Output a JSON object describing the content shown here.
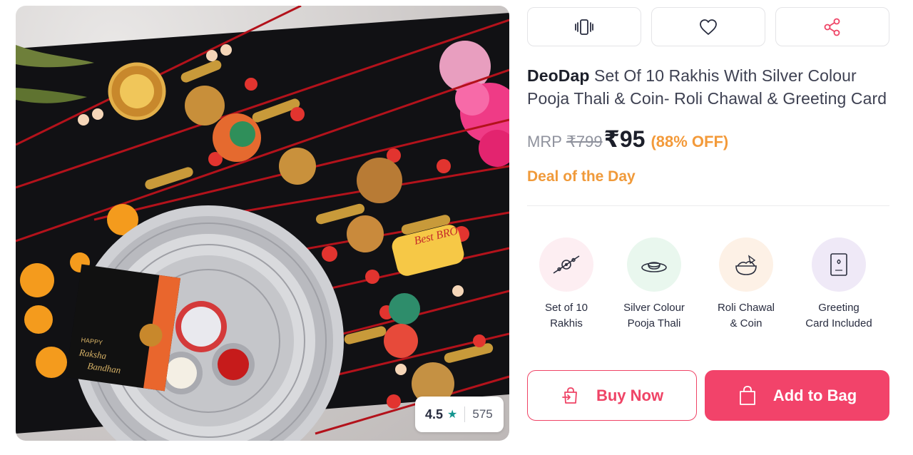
{
  "product": {
    "image_icon": "product-photo-rakhi-set",
    "card_text": [
      "HAPPY",
      "Raksha",
      "Bandhan"
    ],
    "rakhi_text": "Best BRO",
    "rating": "4.5",
    "rating_star_icon": "star-icon",
    "rating_count": "575"
  },
  "actions": {
    "compare_icon": "compare-icon",
    "wishlist_icon": "heart-icon",
    "share_icon": "share-icon"
  },
  "title": {
    "brand": "DeoDap",
    "name": "Set Of 10 Rakhis With Silver Colour Pooja Thali & Coin- Roli Chawal & Greeting Card"
  },
  "price": {
    "mrp_label": "MRP",
    "mrp": "₹799",
    "selling": "₹95",
    "discount": "(88% OFF)"
  },
  "deal": "Deal of the Day",
  "features": [
    {
      "icon": "rakhi-icon",
      "line1": "Set of 10",
      "line2": "Rakhis",
      "bg": "#fdeef2"
    },
    {
      "icon": "pooja-thali-icon",
      "line1": "Silver Colour",
      "line2": "Pooja Thali",
      "bg": "#e9f7ee"
    },
    {
      "icon": "roli-chawal-icon",
      "line1": "Roli Chawal",
      "line2": "& Coin",
      "bg": "#fdf1e6"
    },
    {
      "icon": "greeting-card-icon",
      "line1": "Greeting",
      "line2": "Card Included",
      "bg": "#efe9f7"
    }
  ],
  "cta": {
    "buy_now": "Buy Now",
    "add_to_bag": "Add to Bag",
    "buy_icon": "buy-now-icon",
    "bag_icon": "shopping-bag-icon"
  },
  "colors": {
    "accent": "#ef4466",
    "discount": "#f39a3a",
    "rating_star": "#14958f"
  }
}
